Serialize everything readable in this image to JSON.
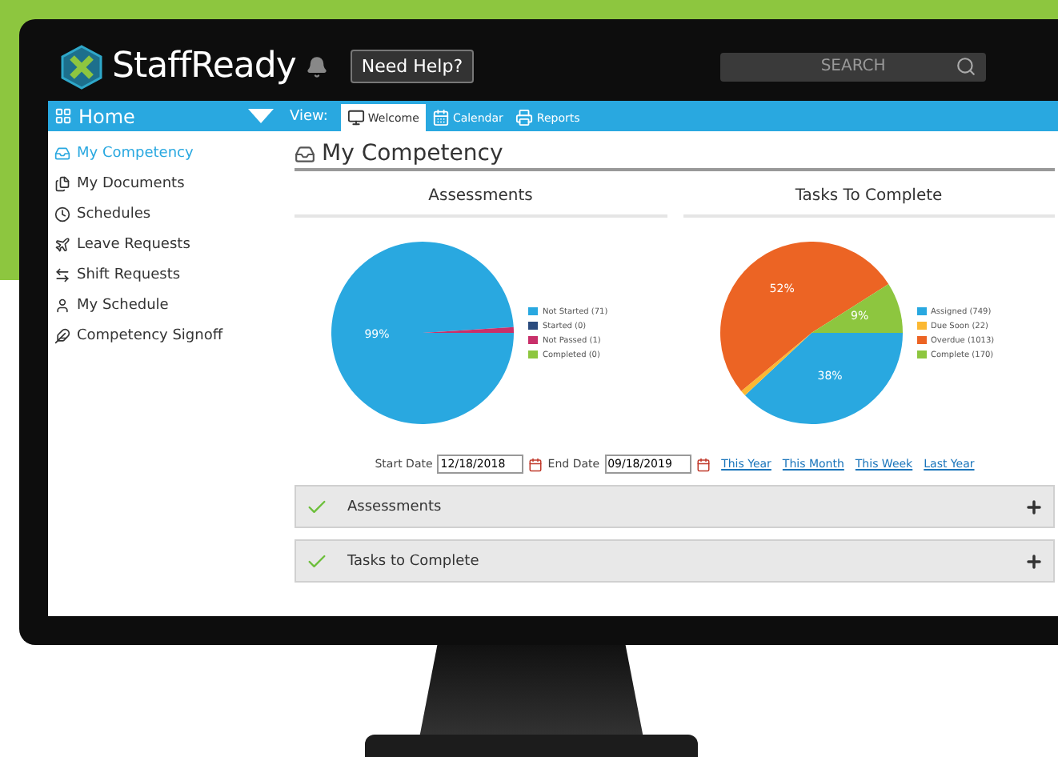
{
  "header": {
    "logo": "StaffReady",
    "help_button": "Need Help?",
    "search": {
      "placeholder": "SEARCH"
    }
  },
  "nav": {
    "home": "Home",
    "view_label": "View:",
    "tabs": [
      {
        "label": "Welcome",
        "kind": "monitor",
        "selected": true
      },
      {
        "label": "Calendar",
        "kind": "calendar",
        "selected": false
      },
      {
        "label": "Reports",
        "kind": "printer",
        "selected": false
      }
    ]
  },
  "sidebar": {
    "items": [
      {
        "label": "My Competency",
        "kind": "inbox",
        "selected": true
      },
      {
        "label": "My Documents",
        "kind": "documents",
        "selected": false
      },
      {
        "label": "Schedules",
        "kind": "clock",
        "selected": false
      },
      {
        "label": "Leave Requests",
        "kind": "plane",
        "selected": false
      },
      {
        "label": "Shift Requests",
        "kind": "swap",
        "selected": false
      },
      {
        "label": "My Schedule",
        "kind": "user",
        "selected": false
      },
      {
        "label": "Competency Signoff",
        "kind": "feather",
        "selected": false
      }
    ]
  },
  "page_title": "My Competency",
  "charts": [
    {
      "chart_data": {
        "type": "pie",
        "title": "Assessments",
        "categories": [
          "Not Started (71)",
          "Started (0)",
          "Not Passed (1)",
          "Completed (0)"
        ],
        "values": [
          99,
          0,
          1,
          0
        ],
        "colors": [
          "#29a8e0",
          "#2b4c7e",
          "#c8306a",
          "#8dc63f"
        ],
        "value_labels": [
          "99%",
          null,
          null,
          null
        ]
      }
    },
    {
      "chart_data": {
        "type": "pie",
        "title": "Tasks To Complete",
        "categories": [
          "Assigned (749)",
          "Due Soon (22)",
          "Overdue (1013)",
          "Complete (170)"
        ],
        "values": [
          38,
          1,
          52,
          9
        ],
        "colors": [
          "#29a8e0",
          "#fbb832",
          "#ec6424",
          "#8dc63f"
        ],
        "value_labels": [
          "38%",
          null,
          "52%",
          "9%"
        ]
      }
    }
  ],
  "date_filter": {
    "start_label": "Start Date",
    "start_value": "12/18/2018",
    "end_label": "End Date",
    "end_value": "09/18/2019",
    "links": [
      "This Year",
      "This Month",
      "This Week",
      "Last Year"
    ]
  },
  "sections": [
    {
      "label": "Assessments",
      "checked": true
    },
    {
      "label": "Tasks to Complete",
      "checked": true
    }
  ]
}
